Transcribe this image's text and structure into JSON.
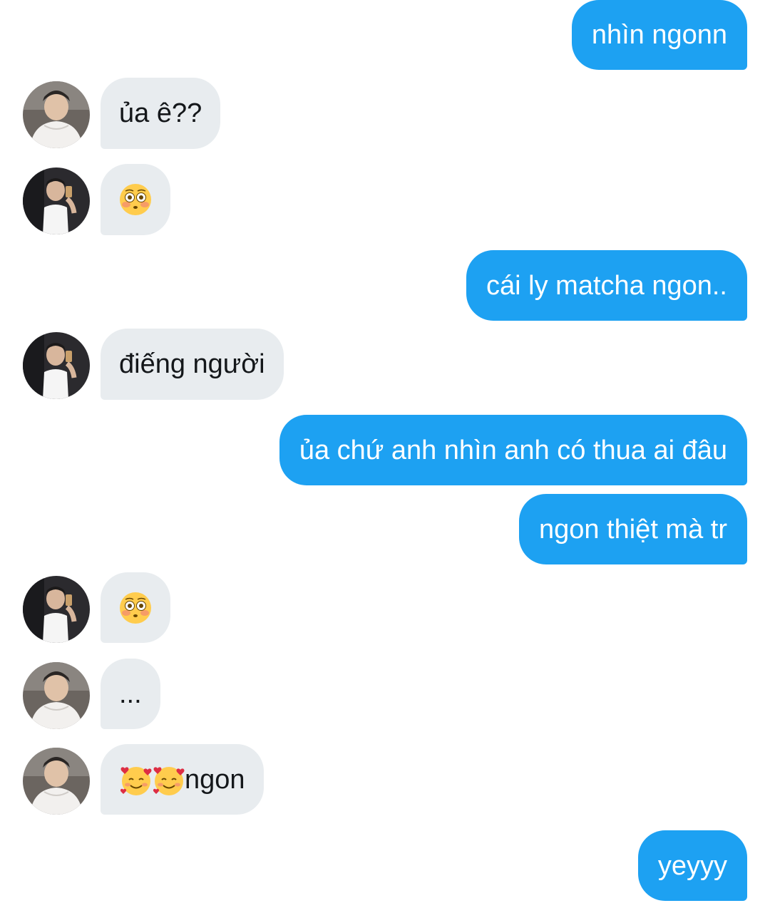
{
  "conversation": {
    "messages": [
      {
        "side": "sent",
        "text": "nhìn ngonn"
      },
      {
        "side": "received",
        "text": "ủa ê??",
        "avatar": "avatar-shirt-icon"
      },
      {
        "side": "received",
        "text": "",
        "emoji": "flushed-face-icon",
        "avatar": "avatar-mirror-selfie-icon"
      },
      {
        "side": "sent",
        "text": "cái ly matcha ngon.."
      },
      {
        "side": "received",
        "text": "điếng người",
        "avatar": "avatar-mirror-selfie-icon"
      },
      {
        "side": "sent",
        "text": "ủa chứ anh nhìn anh có thua ai đâu"
      },
      {
        "side": "sent",
        "text": "ngon thiệt mà tr"
      },
      {
        "side": "received",
        "text": "",
        "emoji": "flushed-face-icon",
        "avatar": "avatar-mirror-selfie-icon"
      },
      {
        "side": "received",
        "text": "...",
        "avatar": "avatar-shirt-icon"
      },
      {
        "side": "received",
        "text": "ngon",
        "emoji": "smiling-face-with-hearts-icon",
        "emoji_count": 2,
        "avatar": "avatar-shirt-icon"
      },
      {
        "side": "sent",
        "text": "yeyyy"
      }
    ]
  },
  "colors": {
    "sent_bubble": "#1da1f2",
    "sent_text": "#ffffff",
    "received_bubble": "#e8ecef",
    "received_text": "#14171a",
    "background": "#ffffff"
  }
}
